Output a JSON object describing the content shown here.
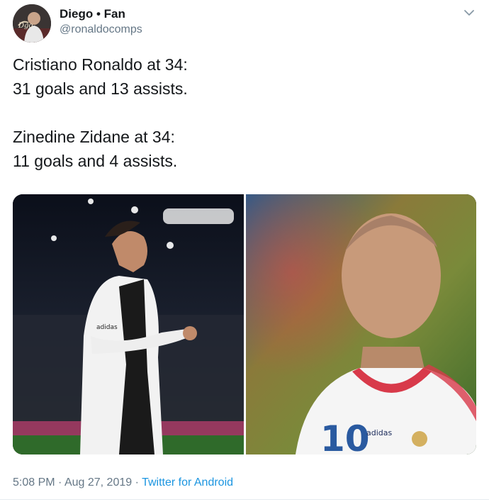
{
  "author": {
    "name": "Diego • Fan",
    "handle": "@ronaldocomps",
    "avatar_icon": "avatar-photo-icon"
  },
  "menu": {
    "icon": "chevron-down-icon"
  },
  "tweet": {
    "lines": [
      "Cristiano Ronaldo at 34:",
      "31 goals and 13 assists.",
      "Zinedine Zidane at 34:",
      "11 goals and 4 assists."
    ]
  },
  "media": {
    "left_jersey_mark": "adidas",
    "right_number": "10",
    "right_brand": "adidas"
  },
  "footer": {
    "time": "5:08 PM",
    "sep1": " · ",
    "date": "Aug 27, 2019",
    "sep2": " · ",
    "source": "Twitter for Android"
  },
  "colors": {
    "link": "#1b95e0",
    "muted": "#657786",
    "text": "#14171a"
  }
}
